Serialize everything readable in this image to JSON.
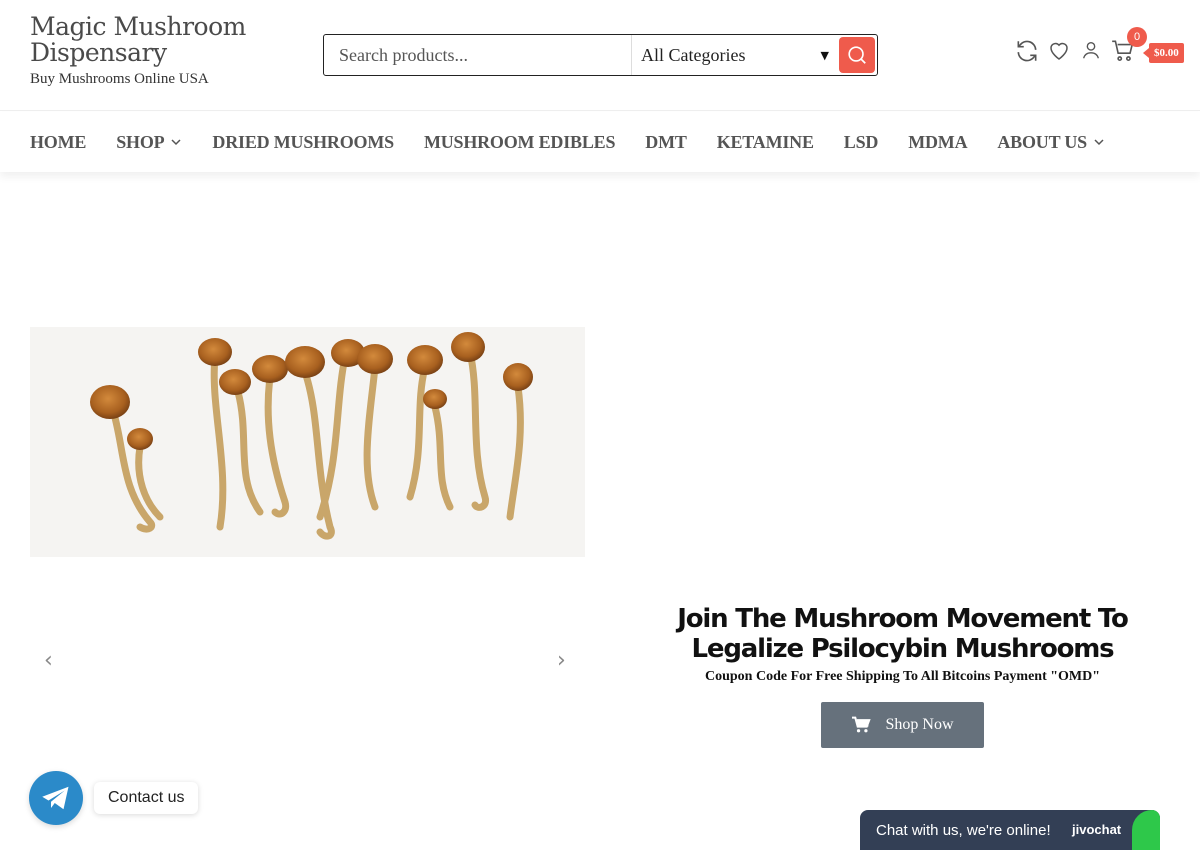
{
  "brand": {
    "title": "Magic Mushroom Dispensary",
    "tagline": "Buy Mushrooms Online USA"
  },
  "search": {
    "placeholder": "Search products...",
    "category": "All Categories"
  },
  "header_icons": [
    "refresh-icon",
    "heart-icon",
    "user-icon",
    "cart-icon"
  ],
  "cart": {
    "count": "0",
    "total": "$0.00"
  },
  "nav": {
    "items": [
      {
        "label": "HOME"
      },
      {
        "label": "SHOP"
      },
      {
        "label": "DRIED MUSHROOMS"
      },
      {
        "label": "MUSHROOM EDIBLES"
      },
      {
        "label": "DMT"
      },
      {
        "label": "KETAMINE"
      },
      {
        "label": "LSD"
      },
      {
        "label": "MDMA"
      },
      {
        "label": "ABOUT US"
      }
    ]
  },
  "hero": {
    "prev": "‹",
    "next": "›",
    "title": "Join The Mushroom Movement To Legalize Psilocybin Mushrooms",
    "subtitle": "Coupon Code For Free Shipping To All Bitcoins Payment \"OMD\"",
    "button": "Shop Now"
  },
  "contact": {
    "label": "Contact us"
  },
  "chat": {
    "text": "Chat with us, we're online!",
    "brand": "jivochat"
  },
  "colors": {
    "accent": "#ef5b4c",
    "button": "#66717c",
    "chat": "#333f55",
    "telegram": "#2b8ac9"
  }
}
